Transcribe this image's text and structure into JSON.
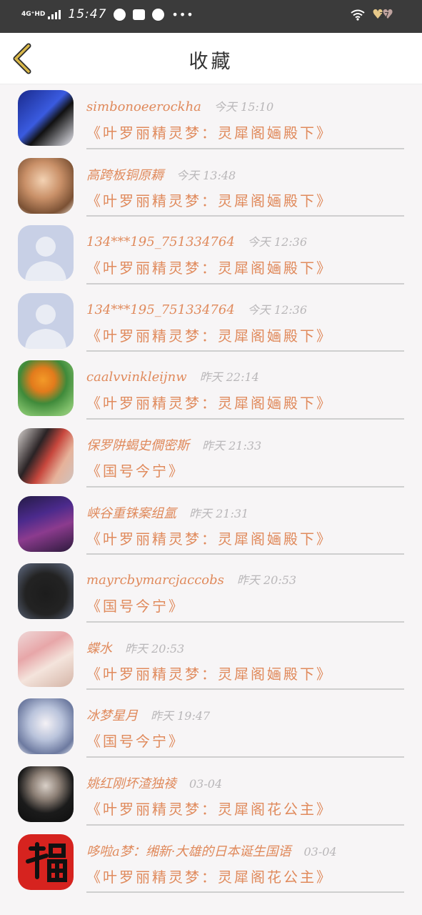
{
  "status_bar": {
    "network": "4G⁺HD",
    "time": "15:47",
    "more": "•••",
    "battery": "37"
  },
  "header": {
    "title": "收藏"
  },
  "items": [
    {
      "name": "simbonoeerockha",
      "time": "今天 15:10",
      "title": "《叶罗丽精灵梦：灵犀阁婳殿下》",
      "avatar": "avatar-1"
    },
    {
      "name": "高跨板铜原耨",
      "time": "今天 13:48",
      "title": "《叶罗丽精灵梦：灵犀阁婳殿下》",
      "avatar": "avatar-2"
    },
    {
      "name": "134***195_751334764",
      "time": "今天 12:36",
      "title": "《叶罗丽精灵梦：灵犀阁婳殿下》",
      "avatar": "default"
    },
    {
      "name": "134***195_751334764",
      "time": "今天 12:36",
      "title": "《叶罗丽精灵梦：灵犀阁婳殿下》",
      "avatar": "default"
    },
    {
      "name": "caalvvinkleijnw",
      "time": "昨天 22:14",
      "title": "《叶罗丽精灵梦：灵犀阁婳殿下》",
      "avatar": "avatar-5"
    },
    {
      "name": "保罗阱蝎史僩密斯",
      "time": "昨天 21:33",
      "title": "《国号今宁》",
      "avatar": "avatar-6"
    },
    {
      "name": "峡谷重铢案组氲",
      "time": "昨天 21:31",
      "title": "《叶罗丽精灵梦：灵犀阁婳殿下》",
      "avatar": "avatar-7"
    },
    {
      "name": "mayrcbymarcjaccobs",
      "time": "昨天 20:53",
      "title": "《国号今宁》",
      "avatar": "avatar-8"
    },
    {
      "name": "蝶水",
      "time": "昨天 20:53",
      "title": "《叶罗丽精灵梦：灵犀阁婳殿下》",
      "avatar": "avatar-9"
    },
    {
      "name": "冰梦星月",
      "time": "昨天 19:47",
      "title": "《国号今宁》",
      "avatar": "avatar-10"
    },
    {
      "name": "姚红刚坏渣独祾",
      "time": "03-04",
      "title": "《叶罗丽精灵梦：灵犀阁花公主》",
      "avatar": "avatar-11"
    },
    {
      "name": "哆啦a梦：缃新·大雄的日本诞生国语",
      "time": "03-04",
      "title": "《叶罗丽精灵梦：灵犀阁花公主》",
      "avatar": "avatar-12"
    }
  ],
  "colors": {
    "accent": "#e08a5c",
    "time_gray": "#b9b7b9",
    "background": "#f7f5f6",
    "status_bar": "#3b3b3b",
    "back_arrow": "#d9b84a"
  }
}
